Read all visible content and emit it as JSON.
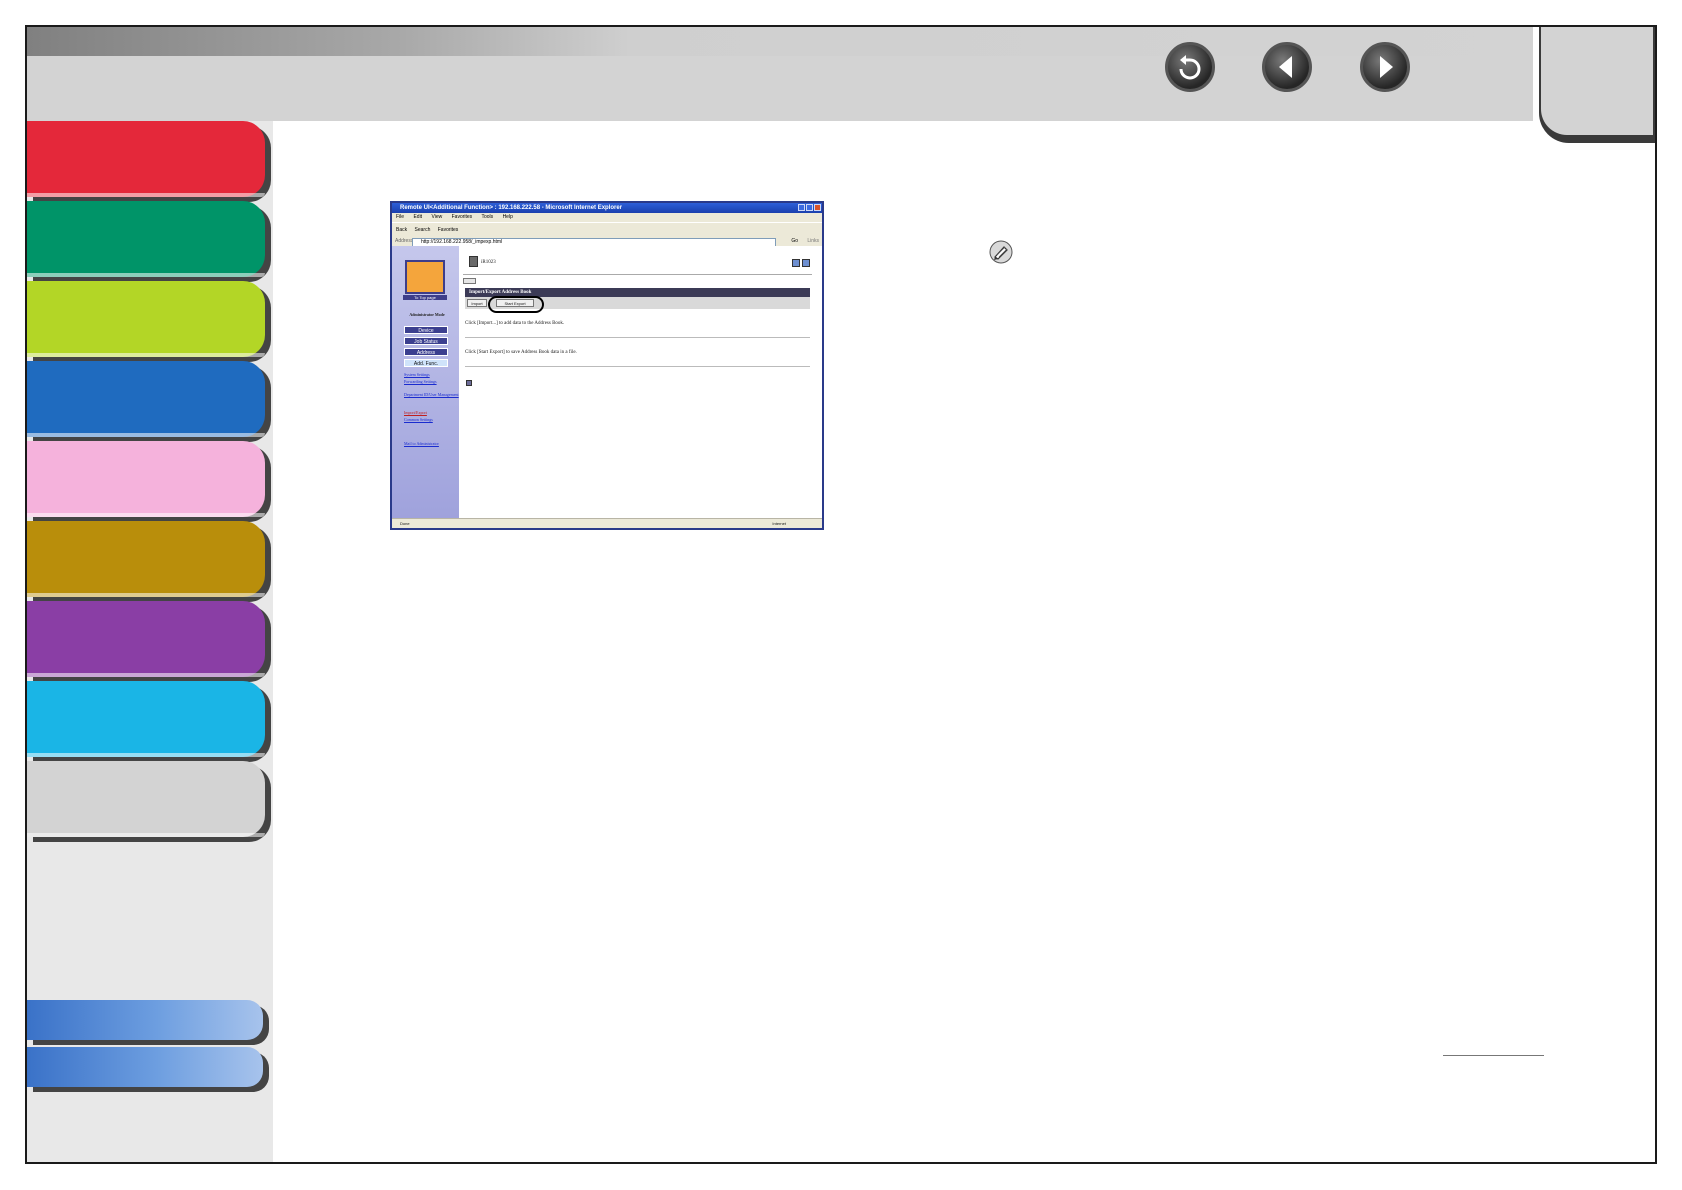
{
  "header": {
    "icons": [
      "back-icon",
      "previous-page-icon",
      "next-page-icon"
    ]
  },
  "sidebar": {
    "chapter_tabs": [
      {
        "color": "#e4283a"
      },
      {
        "color": "#009468"
      },
      {
        "color": "#b3d626"
      },
      {
        "color": "#1f6bbf"
      },
      {
        "color": "#f5b2dc"
      },
      {
        "color": "#b98e0b"
      },
      {
        "color": "#8a3ea5"
      },
      {
        "color": "#1ab5e6"
      },
      {
        "color": "#d3d3d3"
      }
    ],
    "bottom_tabs": [
      {
        "color": "#4f85d6"
      },
      {
        "color": "#4f85d6"
      }
    ]
  },
  "screenshot": {
    "window_title": "Remote UI<Additional Function> : 192.168.222.58 - Microsoft Internet Explorer",
    "menu": [
      "File",
      "Edit",
      "View",
      "Favorites",
      "Tools",
      "Help"
    ],
    "toolbar": [
      "Back",
      "Search",
      "Favorites"
    ],
    "address_label": "Address",
    "address_value": "http://192.168.222.958/_impexp.html",
    "go_label": "Go",
    "links_label": "Links",
    "logo_caption": "To Top page",
    "mode": "Administrator Mode",
    "nav": [
      "Device",
      "Job Status",
      "Address",
      "Add. Func."
    ],
    "sub_links": [
      "System Settings",
      "Forwarding Settings",
      "Department ID/User Management",
      "Import/Export",
      "Common Settings"
    ],
    "help_link": "Mail to Administrator",
    "device_name": "iR1023",
    "section_title": "Import/Export Address Book",
    "import_button": "Import",
    "export_button": "Start Export",
    "import_text": "Click [Import...] to add data to the Address Book.",
    "export_text": "Click [Start Export] to save Address Book data in a file.",
    "status_left": "Done",
    "status_right": "Internet"
  }
}
